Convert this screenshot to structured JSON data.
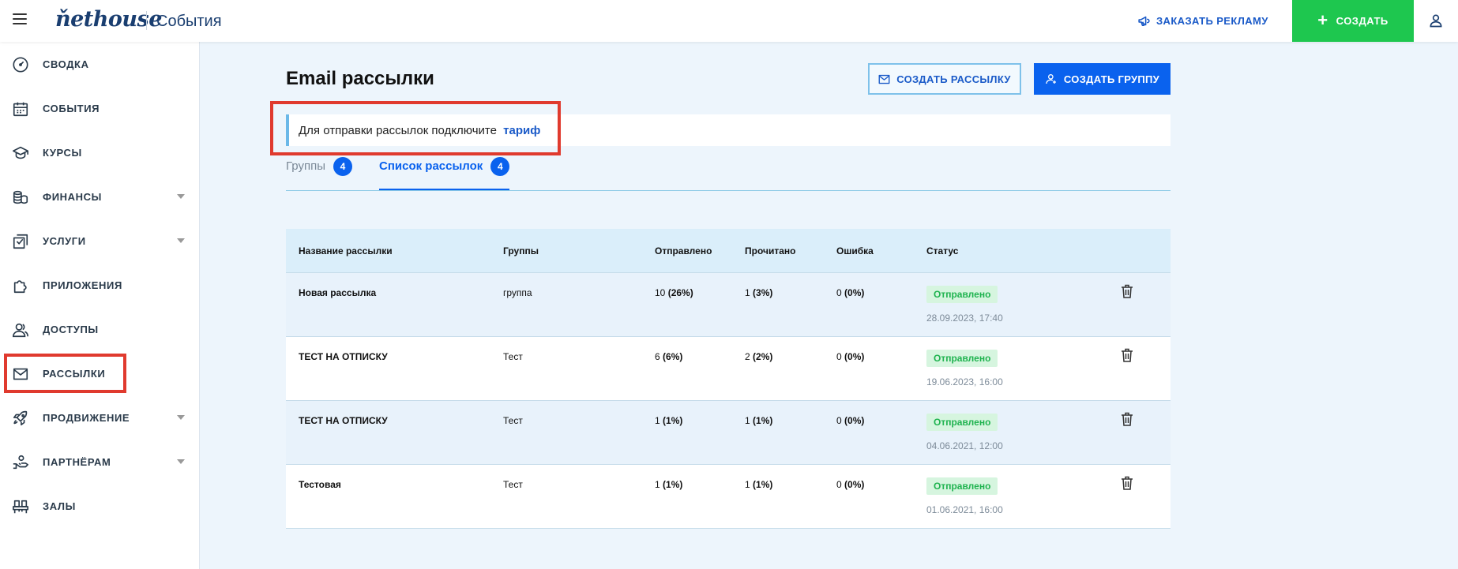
{
  "topbar": {
    "logo": "ňethouse",
    "section": "События",
    "ad_label": "ЗАКАЗАТЬ РЕКЛАМУ",
    "create_label": "СОЗДАТЬ"
  },
  "sidebar": {
    "items": [
      {
        "label": "СВОДКА",
        "icon": "speedometer-icon"
      },
      {
        "label": "СОБЫТИЯ",
        "icon": "calendar-icon"
      },
      {
        "label": "КУРСЫ",
        "icon": "graduation-cap-icon"
      },
      {
        "label": "ФИНАНСЫ",
        "icon": "coins-icon"
      },
      {
        "label": "УСЛУГИ",
        "icon": "folder-icon"
      },
      {
        "label": "ПРИЛОЖЕНИЯ",
        "icon": "puzzle-icon"
      },
      {
        "label": "ДОСТУПЫ",
        "icon": "users-icon"
      },
      {
        "label": "РАССЫЛКИ",
        "icon": "mail-icon"
      },
      {
        "label": "ПРОДВИЖЕНИЕ",
        "icon": "rocket-icon"
      },
      {
        "label": "ПАРТНЁРАМ",
        "icon": "handshake-icon"
      },
      {
        "label": "ЗАЛЫ",
        "icon": "chairs-icon"
      }
    ]
  },
  "page": {
    "title": "Email рассылки",
    "create_mailing": "СОЗДАТЬ РАССЫЛКУ",
    "create_group": "СОЗДАТЬ ГРУППУ",
    "notice_text": "Для отправки рассылок подключите",
    "notice_link": "тариф"
  },
  "tabs": [
    {
      "label": "Группы",
      "count": "4"
    },
    {
      "label": "Список рассылок",
      "count": "4"
    }
  ],
  "table": {
    "headers": [
      "Название рассылки",
      "Группы",
      "Отправлено",
      "Прочитано",
      "Ошибка",
      "Статус"
    ],
    "rows": [
      {
        "name": "Новая рассылка",
        "group": "группа",
        "sent": "10",
        "sent_pct": "(26%)",
        "read": "1",
        "read_pct": "(3%)",
        "err": "0",
        "err_pct": "(0%)",
        "status": "Отправлено",
        "date": "28.09.2023, 17:40"
      },
      {
        "name": "ТЕСТ НА ОТПИСКУ",
        "group": "Тест",
        "sent": "6",
        "sent_pct": "(6%)",
        "read": "2",
        "read_pct": "(2%)",
        "err": "0",
        "err_pct": "(0%)",
        "status": "Отправлено",
        "date": "19.06.2023, 16:00"
      },
      {
        "name": "ТЕСТ НА ОТПИСКУ",
        "group": "Тест",
        "sent": "1",
        "sent_pct": "(1%)",
        "read": "1",
        "read_pct": "(1%)",
        "err": "0",
        "err_pct": "(0%)",
        "status": "Отправлено",
        "date": "04.06.2021, 12:00"
      },
      {
        "name": "Тестовая",
        "group": "Тест",
        "sent": "1",
        "sent_pct": "(1%)",
        "read": "1",
        "read_pct": "(1%)",
        "err": "0",
        "err_pct": "(0%)",
        "status": "Отправлено",
        "date": "01.06.2021, 16:00"
      }
    ]
  },
  "colors": {
    "accent": "#0a62ee",
    "create_green": "#1ec74f",
    "highlight_red": "#e03a2e",
    "status_green": "#1fb34f"
  }
}
